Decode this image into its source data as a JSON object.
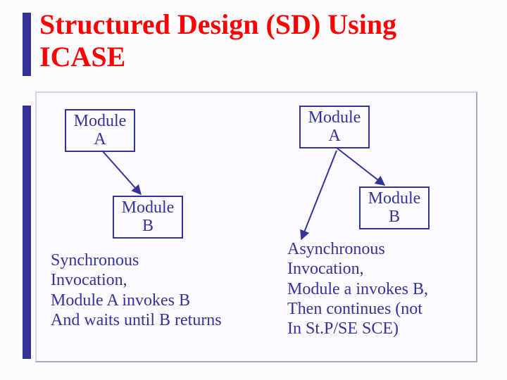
{
  "title": "Structured Design (SD) Using ICASE",
  "left": {
    "moduleA": "Module\nA",
    "moduleB": "Module\nB",
    "caption": "Synchronous\nInvocation,\nModule A invokes B\nAnd waits until B returns"
  },
  "right": {
    "moduleA": "Module\nA",
    "moduleB": "Module\nB",
    "caption": "Asynchronous\nInvocation,\nModule a invokes B,\nThen continues (not\nIn St.P/SE SCE)"
  },
  "colors": {
    "accent": "#333399",
    "titleColor": "#ff0000"
  }
}
